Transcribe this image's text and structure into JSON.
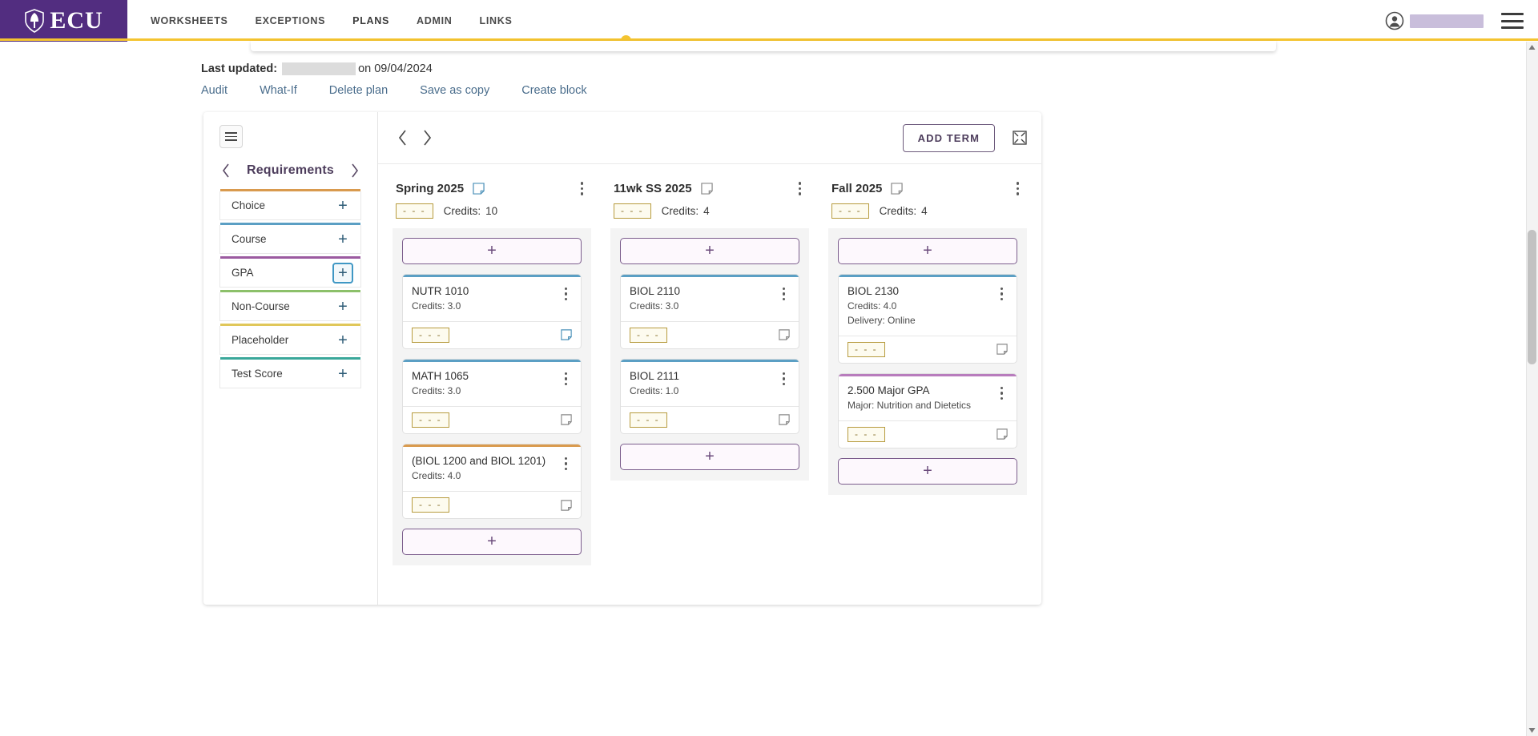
{
  "header": {
    "brand": "ECU",
    "brand_icon": "ecu-shield-logo",
    "nav": [
      {
        "label": "WORKSHEETS",
        "active": false
      },
      {
        "label": "EXCEPTIONS",
        "active": false
      },
      {
        "label": "PLANS",
        "active": true
      },
      {
        "label": "ADMIN",
        "active": false
      },
      {
        "label": "LINKS",
        "active": false
      }
    ],
    "user_name_redacted": "",
    "user_icon": "user-avatar-icon",
    "menu_icon": "hamburger-menu-icon"
  },
  "meta": {
    "last_updated_label": "Last updated:",
    "last_updated_user_redacted": "",
    "last_updated_on": "on 09/04/2024"
  },
  "actions": [
    {
      "label": "Audit"
    },
    {
      "label": "What-If"
    },
    {
      "label": "Delete plan"
    },
    {
      "label": "Save as copy"
    },
    {
      "label": "Create block"
    }
  ],
  "sidebar": {
    "menu_icon": "hamburger-menu-icon",
    "prev_icon": "chevron-left-icon",
    "next_icon": "chevron-right-icon",
    "title": "Requirements",
    "items": [
      {
        "label": "Choice",
        "color": "#d99a4e",
        "add_label": "+",
        "focused": false
      },
      {
        "label": "Course",
        "color": "#5b9fc4",
        "add_label": "+",
        "focused": false
      },
      {
        "label": "GPA",
        "color": "#9b5aa0",
        "add_label": "+",
        "focused": true
      },
      {
        "label": "Non-Course",
        "color": "#8cc06a",
        "add_label": "+",
        "focused": false
      },
      {
        "label": "Placeholder",
        "color": "#e0c75a",
        "add_label": "+",
        "focused": false
      },
      {
        "label": "Test Score",
        "color": "#3aa79a",
        "add_label": "+",
        "focused": false
      }
    ]
  },
  "board": {
    "prev_icon": "chevron-left-icon",
    "next_icon": "chevron-right-icon",
    "add_term_label": "ADD TERM",
    "expand_icon": "expand-fullscreen-icon",
    "terms": [
      {
        "name": "Spring 2025",
        "note_icon": "note-filled-icon",
        "note_active": true,
        "kebab_icon": "more-vertical-icon",
        "grade_placeholder": "- - -",
        "credits_label": "Credits:",
        "credits_value": "10",
        "add_label": "+",
        "cards": [
          {
            "title": "NUTR 1010",
            "color": "#5b9fc4",
            "lines": [
              "Credits: 3.0"
            ],
            "grade_placeholder": "- - -",
            "note_icon": "note-filled-icon",
            "note_active": true
          },
          {
            "title": "MATH 1065",
            "color": "#5b9fc4",
            "lines": [
              "Credits: 3.0"
            ],
            "grade_placeholder": "- - -",
            "note_icon": "note-outline-icon",
            "note_active": false
          },
          {
            "title": "(BIOL 1200 and BIOL 1201)",
            "color": "#d99a4e",
            "lines": [
              "Credits: 4.0"
            ],
            "grade_placeholder": "- - -",
            "note_icon": "note-outline-icon",
            "note_active": false
          }
        ]
      },
      {
        "name": "11wk SS 2025",
        "note_icon": "note-outline-icon",
        "note_active": false,
        "kebab_icon": "more-vertical-icon",
        "grade_placeholder": "- - -",
        "credits_label": "Credits:",
        "credits_value": "4",
        "add_label": "+",
        "cards": [
          {
            "title": "BIOL 2110",
            "color": "#5b9fc4",
            "lines": [
              "Credits: 3.0"
            ],
            "grade_placeholder": "- - -",
            "note_icon": "note-outline-icon",
            "note_active": false
          },
          {
            "title": "BIOL 2111",
            "color": "#5b9fc4",
            "lines": [
              "Credits: 1.0"
            ],
            "grade_placeholder": "- - -",
            "note_icon": "note-outline-icon",
            "note_active": false
          }
        ]
      },
      {
        "name": "Fall 2025",
        "note_icon": "note-outline-icon",
        "note_active": false,
        "kebab_icon": "more-vertical-icon",
        "grade_placeholder": "- - -",
        "credits_label": "Credits:",
        "credits_value": "4",
        "add_label": "+",
        "cards": [
          {
            "title": "BIOL 2130",
            "color": "#5b9fc4",
            "lines": [
              "Credits: 4.0",
              "Delivery: Online"
            ],
            "grade_placeholder": "- - -",
            "note_icon": "note-outline-icon",
            "note_active": false
          },
          {
            "title": "2.500 Major GPA",
            "color": "#b87cbd",
            "lines": [
              "Major: Nutrition and Dietetics"
            ],
            "grade_placeholder": "- - -",
            "note_icon": "note-outline-icon",
            "note_active": false
          }
        ]
      }
    ]
  },
  "colors": {
    "brand_purple": "#522d80",
    "accent_gold": "#f4c430",
    "link_blue": "#4a6d8c"
  }
}
